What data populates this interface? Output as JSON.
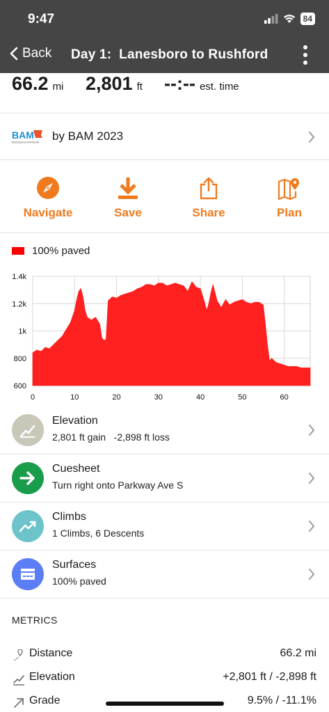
{
  "status_bar": {
    "time": "9:47",
    "battery": "84"
  },
  "nav": {
    "back_label": "Back",
    "title": "Day 1:  Lanesboro to Rushford"
  },
  "stats": {
    "distance": {
      "value": "66.2",
      "unit": "mi"
    },
    "elevation": {
      "value": "2,801",
      "unit": "ft"
    },
    "time": {
      "value": "--:--",
      "unit": "est. time"
    }
  },
  "owner": {
    "logo_text": "BAM",
    "logo_tagline": "Bicycling Around Minnesota",
    "label": "by BAM 2023"
  },
  "actions": [
    {
      "label": "Navigate",
      "icon": "compass-icon"
    },
    {
      "label": "Save",
      "icon": "download-icon"
    },
    {
      "label": "Share",
      "icon": "share-icon"
    },
    {
      "label": "Plan",
      "icon": "map-pin-icon"
    }
  ],
  "surface_legend": {
    "label": "100% paved",
    "color": "#ff0000"
  },
  "chart_data": {
    "type": "area",
    "x_ticks": [
      "0",
      "10",
      "20",
      "30",
      "40",
      "50",
      "60"
    ],
    "y_ticks": [
      "600",
      "800",
      "1k",
      "1.2k",
      "1.4k"
    ],
    "xlim": [
      0,
      66.2
    ],
    "ylim": [
      600,
      1400
    ],
    "fill_color": "#ff2020",
    "series": [
      {
        "x": [
          0,
          1,
          2,
          3,
          4,
          5,
          6,
          7,
          8,
          9,
          10,
          10.5,
          11,
          11.5,
          12,
          12.5,
          13,
          14,
          15,
          16,
          16.5,
          17,
          17.5,
          18,
          19,
          20,
          21,
          22,
          23,
          24,
          25,
          26,
          27,
          28,
          29,
          30,
          31,
          32,
          33,
          34,
          35,
          36,
          37,
          38,
          39,
          40,
          41,
          41.5,
          42,
          42.5,
          43,
          44,
          45,
          46,
          47,
          48,
          49,
          50,
          51,
          52,
          53,
          54,
          55,
          55.5,
          56,
          56.5,
          57,
          58,
          59,
          60,
          61,
          62,
          63,
          64,
          65,
          66.2
        ],
        "y": [
          840,
          860,
          850,
          880,
          870,
          900,
          930,
          960,
          1010,
          1060,
          1150,
          1230,
          1290,
          1310,
          1250,
          1150,
          1100,
          1080,
          1100,
          1050,
          950,
          930,
          940,
          1220,
          1250,
          1240,
          1260,
          1270,
          1280,
          1290,
          1310,
          1320,
          1340,
          1340,
          1330,
          1350,
          1350,
          1330,
          1340,
          1350,
          1340,
          1330,
          1290,
          1360,
          1320,
          1310,
          1210,
          1150,
          1200,
          1280,
          1340,
          1220,
          1170,
          1230,
          1190,
          1210,
          1220,
          1230,
          1210,
          1200,
          1210,
          1210,
          1190,
          1050,
          900,
          780,
          800,
          770,
          760,
          750,
          740,
          740,
          740,
          730,
          730,
          730
        ]
      }
    ]
  },
  "rows": [
    {
      "title": "Elevation",
      "subtitle": "2,801 ft gain   -2,898 ft loss",
      "icon": "elevation-icon",
      "color": "#c9c7b8"
    },
    {
      "title": "Cuesheet",
      "subtitle": "Turn right onto Parkway Ave S",
      "icon": "arrow-right-icon",
      "color": "#1a9d4a"
    },
    {
      "title": "Climbs",
      "subtitle": "1 Climbs, 6 Descents",
      "icon": "trend-up-icon",
      "color": "#6cc3c9"
    },
    {
      "title": "Surfaces",
      "subtitle": "100% paved",
      "icon": "road-icon",
      "color": "#5b7df5"
    }
  ],
  "metrics": {
    "heading": "METRICS",
    "items": [
      {
        "label": "Distance",
        "value": "66.2 mi",
        "icon": "distance-icon"
      },
      {
        "label": "Elevation",
        "value": "+2,801 ft / -2,898 ft",
        "icon": "elevation-small-icon"
      },
      {
        "label": "Grade",
        "value": "9.5% / -11.1%",
        "icon": "grade-arrow-icon"
      }
    ]
  },
  "colors": {
    "accent": "#f07a1e",
    "header_bg": "#454545",
    "chart_fill": "#ff2020"
  }
}
